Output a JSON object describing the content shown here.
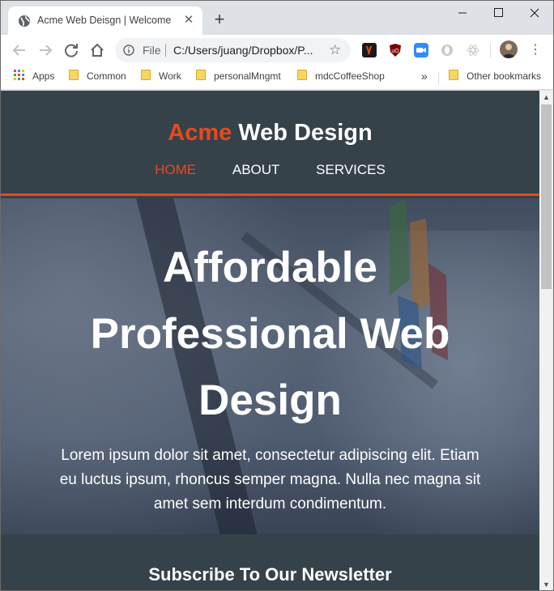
{
  "browser": {
    "tab": {
      "title": "Acme Web Deisgn | Welcome",
      "close": "✕"
    },
    "new_tab": "+",
    "window_controls": {
      "minimize": "—",
      "maximize": "☐",
      "close": "✕"
    },
    "address": {
      "scheme": "File",
      "url": "C:/Users/juang/Dropbox/P..."
    },
    "menu": "⋮"
  },
  "bookmarks": {
    "apps": "Apps",
    "items": [
      "Common",
      "Work",
      "personalMngmt",
      "mdcCoffeeShop"
    ],
    "more": "»",
    "other": "Other bookmarks"
  },
  "site": {
    "brand_highlight": "Acme",
    "brand_rest": " Web Design",
    "nav": [
      "HOME",
      "ABOUT",
      "SERVICES"
    ],
    "hero_title": "Affordable Professional Web Design",
    "hero_text": "Lorem ipsum dolor sit amet, consectetur adipiscing elit. Etiam eu luctus ipsum, rhoncus semper magna. Nulla nec magna sit amet sem interdum condimentum.",
    "newsletter_title": "Subscribe To Our Newsletter"
  },
  "colors": {
    "accent": "#e8491d",
    "header_bg": "#35424a",
    "chrome_bg": "#dee1e6"
  }
}
